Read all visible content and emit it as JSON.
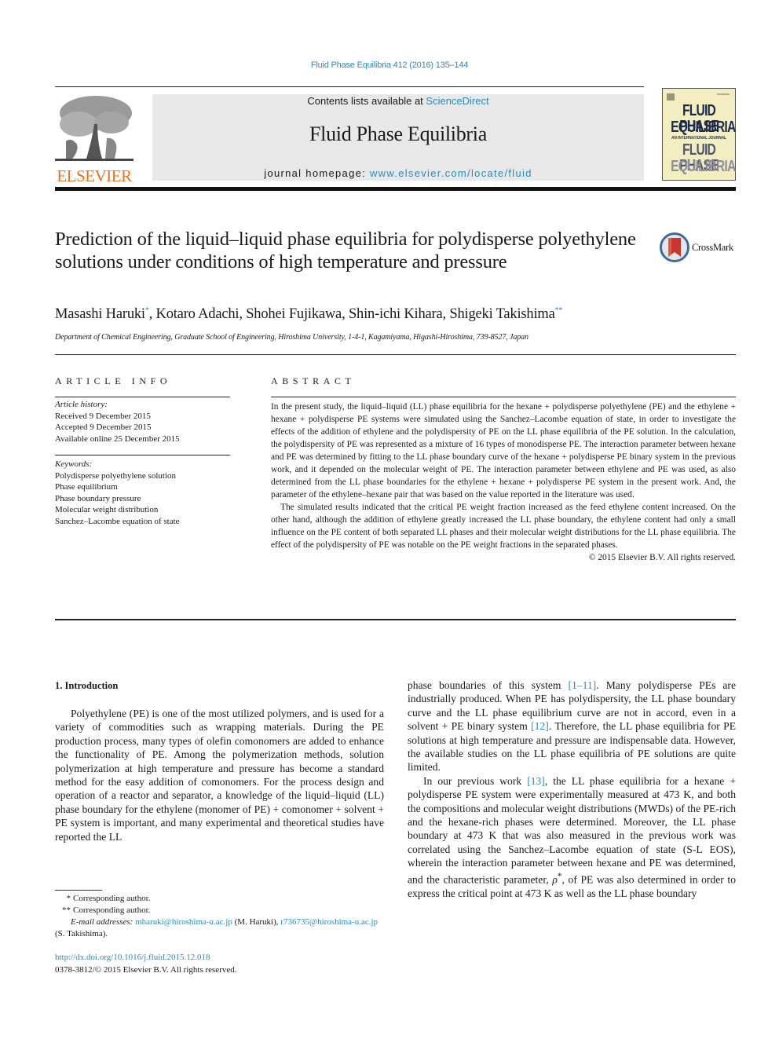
{
  "header": {
    "citation": "Fluid Phase Equilibria 412 (2016) 135–144",
    "contents_prefix": "Contents lists available at ",
    "contents_link": "ScienceDirect",
    "journal_title": "Fluid Phase Equilibria",
    "homepage_prefix": "journal homepage: ",
    "homepage_link": "www.elsevier.com/locate/fluid",
    "publisher_logo": "ELSEVIER",
    "cover": {
      "line1": "FLUID PHASE",
      "line2": "EQUILIBRIA",
      "line3": "AN INTERNATIONAL JOURNAL",
      "line4": "FLUID PHASE",
      "line5": "EQUILIBRIA"
    },
    "colors": {
      "link": "#2a8ab8",
      "elsevier_orange": "#e9711c",
      "banner_gray": "#e8e8e8",
      "cover_bg": "#f3eec1"
    }
  },
  "article": {
    "title": "Prediction of the liquid–liquid phase equilibria for polydisperse polyethylene solutions under conditions of high temperature and pressure",
    "crossmark": "CrossMark",
    "authors": [
      {
        "name": "Masashi Haruki",
        "mark": "*"
      },
      {
        "name": "Kotaro Adachi",
        "mark": ""
      },
      {
        "name": "Shohei Fujikawa",
        "mark": ""
      },
      {
        "name": "Shin-ichi Kihara",
        "mark": ""
      },
      {
        "name": "Shigeki Takishima",
        "mark": "**"
      }
    ],
    "affiliation": "Department of Chemical Engineering, Graduate School of Engineering, Hiroshima University, 1-4-1, Kagamiyama, Higashi-Hiroshima, 739-8527, Japan"
  },
  "article_info": {
    "heading": "ARTICLE INFO",
    "history_label": "Article history:",
    "history": [
      "Received 9 December 2015",
      "Accepted 9 December 2015",
      "Available online 25 December 2015"
    ],
    "keywords_label": "Keywords:",
    "keywords": [
      "Polydisperse polyethylene solution",
      "Phase equilibrium",
      "Phase boundary pressure",
      "Molecular weight distribution",
      "Sanchez–Lacombe equation of state"
    ]
  },
  "abstract": {
    "heading": "ABSTRACT",
    "paragraphs": [
      "In the present study, the liquid–liquid (LL) phase equilibria for the hexane + polydisperse polyethylene (PE) and the ethylene + hexane + polydisperse PE systems were simulated using the Sanchez–Lacombe equation of state, in order to investigate the effects of the addition of ethylene and the polydispersity of PE on the LL phase equilibria of the PE solution. In the calculation, the polydispersity of PE was represented as a mixture of 16 types of monodisperse PE. The interaction parameter between hexane and PE was determined by fitting to the LL phase boundary curve of the hexane + polydisperse PE binary system in the previous work, and it depended on the molecular weight of PE. The interaction parameter between ethylene and PE was used, as also determined from the LL phase boundaries for the ethylene + hexane + polydisperse PE system in the present work. And, the parameter of the ethylene–hexane pair that was based on the value reported in the literature was used.",
      "The simulated results indicated that the critical PE weight fraction increased as the feed ethylene content increased. On the other hand, although the addition of ethylene greatly increased the LL phase boundary, the ethylene content had only a small influence on the PE content of both separated LL phases and their molecular weight distributions for the LL phase equilibria. The effect of the polydispersity of PE was notable on the PE weight fractions in the separated phases."
    ],
    "copyright": "© 2015 Elsevier B.V. All rights reserved."
  },
  "body": {
    "section_heading": "1.  Introduction",
    "left_paragraph": "Polyethylene (PE) is one of the most utilized polymers, and is used for a variety of commodities such as wrapping materials. During the PE production process, many types of olefin comonomers are added to enhance the functionality of PE. Among the polymerization methods, solution polymerization at high temperature and pressure has become a standard method for the easy addition of comonomers. For the process design and operation of a reactor and separator, a knowledge of the liquid–liquid (LL) phase boundary for the ethylene (monomer of PE) + comonomer + solvent + PE system is important, and many experimental and theoretical studies have reported the LL",
    "right_p1": {
      "t1": "phase boundaries of this system ",
      "ref1": "[1–11]",
      "t2": ". Many polydisperse PEs are industrially produced. When PE has polydispersity, the LL phase boundary curve and the LL phase equilibrium curve are not in accord, even in a solvent + PE binary system ",
      "ref2": "[12]",
      "t3": ". Therefore, the LL phase equilibria for PE solutions at high temperature and pressure are indispensable data. However, the available studies on the LL phase equilibria of PE solutions are quite limited."
    },
    "right_p2": {
      "t1": "In our previous work ",
      "ref1": "[13]",
      "t2": ", the LL phase equilibria for a hexane + polydisperse PE system were experimentally measured at 473 K, and both the compositions and molecular weight distributions (MWDs) of the PE-rich and the hexane-rich phases were determined. Moreover, the LL phase boundary at 473 K that was also measured in the previous work was correlated using the Sanchez–Lacombe equation of state (S-L EOS), wherein the interaction parameter between hexane and PE was determined, and the characteristic parameter, ",
      "symbol": "ρ",
      "symbol_sup": "*",
      "t3": ", of PE was also determined in order to express the critical point at 473 K as well as the LL phase boundary"
    }
  },
  "footnotes": {
    "items": [
      {
        "mark": "*",
        "text": "Corresponding author."
      },
      {
        "mark": "**",
        "text": "Corresponding author."
      }
    ],
    "email_label": "E-mail addresses:",
    "email1": "mharuki@hiroshima-u.ac.jp",
    "email1_owner": " (M. Haruki), ",
    "email2": "r736735@hiroshima-u.ac.jp",
    "email2_owner": " (S. Takishima)."
  },
  "doi": {
    "link": "http://dx.doi.org/10.1016/j.fluid.2015.12.018",
    "issn_line": "0378-3812/© 2015 Elsevier B.V. All rights reserved."
  }
}
